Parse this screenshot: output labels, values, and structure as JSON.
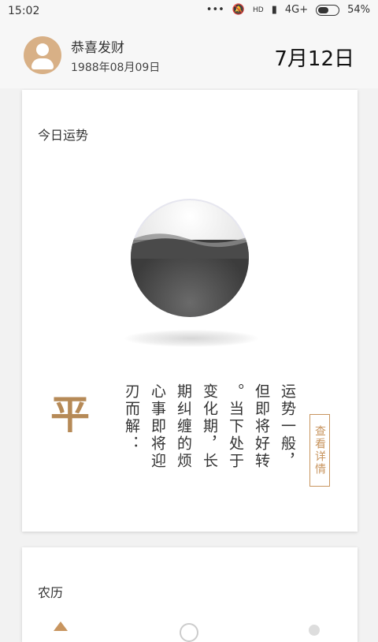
{
  "status_bar": {
    "time": "15:02",
    "dots": "•••",
    "mute_icon": "mute-icon",
    "hd": "HD",
    "signal": "4G+",
    "battery": "54%",
    "battery_level": 0.54
  },
  "profile": {
    "name": "恭喜发财",
    "birth": "1988年08月09日"
  },
  "date": "7月12日",
  "fortune": {
    "title": "今日运势",
    "level": "平",
    "columns": [
      "运势一般，",
      "但即将好转",
      "。当下处于",
      "变化期，长",
      "期纠缠的烦",
      "心事即将迎",
      "刃而解："
    ],
    "detail_button": "查看详情"
  },
  "lunar": {
    "title": "农历"
  },
  "colors": {
    "accent": "#c8955f",
    "avatar": "#d8b086"
  }
}
